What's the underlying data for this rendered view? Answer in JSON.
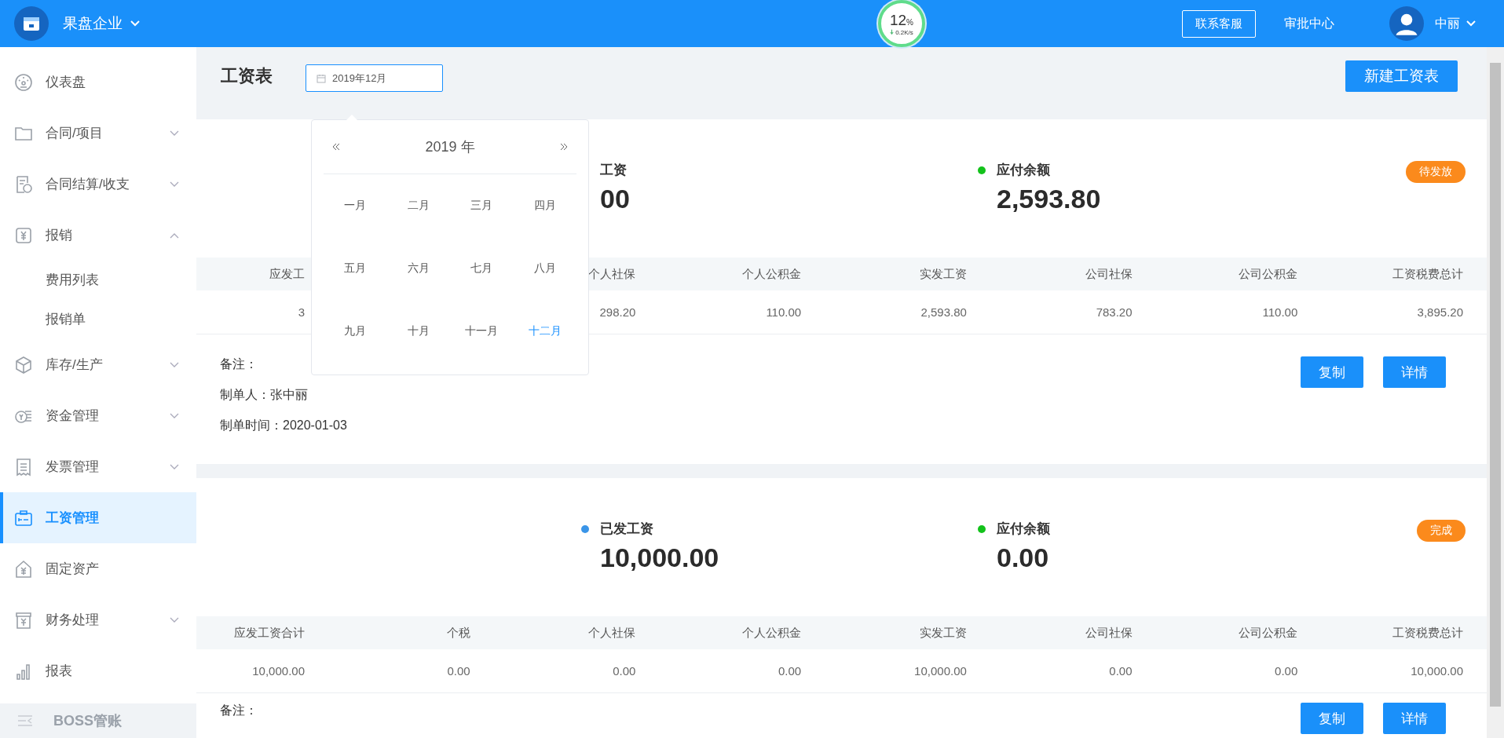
{
  "header": {
    "company": "果盘企业",
    "speed_ball": {
      "percent": "12",
      "unit": "%",
      "speed": "0.2K/s"
    },
    "support_button": "联系客服",
    "approval_link": "审批中心",
    "user": "中丽"
  },
  "sidebar": {
    "items": [
      {
        "label": "仪表盘",
        "selected": false
      },
      {
        "label": "合同/项目",
        "selected": false,
        "expanded": false
      },
      {
        "label": "合同结算/收支",
        "selected": false,
        "expanded": false
      },
      {
        "label": "报销",
        "selected": false,
        "expanded": true,
        "children": [
          {
            "label": "费用列表",
            "selected": false
          },
          {
            "label": "报销单",
            "selected": false
          }
        ]
      },
      {
        "label": "库存/生产",
        "selected": false,
        "expanded": false
      },
      {
        "label": "资金管理",
        "selected": false,
        "expanded": false
      },
      {
        "label": "发票管理",
        "selected": false,
        "expanded": false
      },
      {
        "label": "工资管理",
        "selected": true
      },
      {
        "label": "固定资产",
        "selected": false
      },
      {
        "label": "财务处理",
        "selected": false,
        "expanded": false
      },
      {
        "label": "报表",
        "selected": false
      }
    ],
    "footer": "BOSS管账"
  },
  "page": {
    "title": "工资表",
    "month_picker": {
      "value": "2019年12月",
      "popup": {
        "year": "2019 年",
        "months": [
          {
            "label": "一月",
            "selected": false
          },
          {
            "label": "二月",
            "selected": false
          },
          {
            "label": "三月",
            "selected": false
          },
          {
            "label": "四月",
            "selected": false
          },
          {
            "label": "五月",
            "selected": false
          },
          {
            "label": "六月",
            "selected": false
          },
          {
            "label": "七月",
            "selected": false
          },
          {
            "label": "八月",
            "selected": false
          },
          {
            "label": "九月",
            "selected": false
          },
          {
            "label": "十月",
            "selected": false
          },
          {
            "label": "十一月",
            "selected": false
          },
          {
            "label": "十二月",
            "selected": true
          }
        ]
      }
    },
    "new_button": "新建工资表"
  },
  "cards": [
    {
      "status": "待发放",
      "stats": [
        {
          "label": "工资",
          "value": "00"
        },
        {
          "label": "应付余额",
          "value": "2,593.80",
          "color": "#13c21b"
        }
      ],
      "table": {
        "columns": [
          "应发工",
          "个人社保",
          "个人公积金",
          "实发工资",
          "公司社保",
          "公司公积金",
          "工资税费总计"
        ],
        "values": [
          "3",
          "298.20",
          "110.00",
          "2,593.80",
          "783.20",
          "110.00",
          "3,895.20"
        ]
      },
      "remark": "备注：",
      "creator": "制单人：张中丽",
      "created_time": "制单时间：2020-01-03",
      "buttons": [
        "复制",
        "详情"
      ]
    },
    {
      "status": "完成",
      "stats": [
        {
          "label": "已发工资",
          "value": "10,000.00",
          "color": "#3a95e8"
        },
        {
          "label": "应付余额",
          "value": "0.00",
          "color": "#13c21b"
        }
      ],
      "table": {
        "columns": [
          "应发工资合计",
          "个税",
          "个人社保",
          "个人公积金",
          "实发工资",
          "公司社保",
          "公司公积金",
          "工资税费总计"
        ],
        "values": [
          "10,000.00",
          "0.00",
          "0.00",
          "0.00",
          "10,000.00",
          "0.00",
          "0.00",
          "10,000.00"
        ]
      },
      "remark": "备注：",
      "buttons": [
        "复制",
        "详情"
      ]
    }
  ]
}
